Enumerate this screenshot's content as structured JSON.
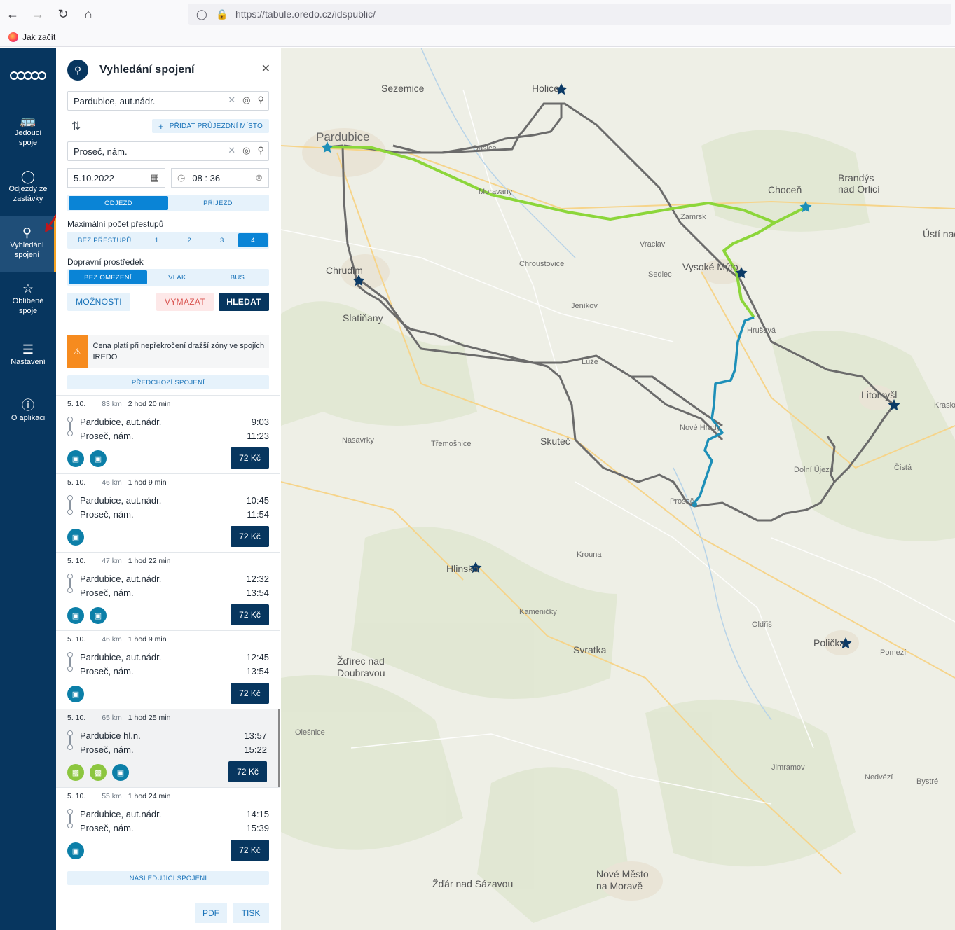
{
  "browser": {
    "url": "https://tabule.oredo.cz/idspublic/",
    "bookmark": "Jak začít"
  },
  "rail": {
    "logo": "OREDO",
    "items": [
      {
        "label": "Jedoucí spoje",
        "icon": "bus-icon"
      },
      {
        "label": "Odjezdy ze zastávky",
        "icon": "departures-icon"
      },
      {
        "label": "Vyhledání spojení",
        "icon": "search-icon"
      },
      {
        "label": "Oblíbené spoje",
        "icon": "star-icon"
      },
      {
        "label": "Nastavení",
        "icon": "sliders-icon"
      },
      {
        "label": "O aplikaci",
        "icon": "help-icon"
      }
    ]
  },
  "panel": {
    "title": "Vyhledání spojení",
    "from": "Pardubice, aut.nádr.",
    "to": "Proseč, nám.",
    "via_label": "PŘIDAT PRŮJEZDNÍ MÍSTO",
    "date": "5.10.2022",
    "time": "08 : 36",
    "direction": {
      "options": [
        "ODJEZD",
        "PŘÍJEZD"
      ],
      "selected": "ODJEZD"
    },
    "transfers_label": "Maximální počet přestupů",
    "transfers": {
      "options": [
        "BEZ PŘESTUPŮ",
        "1",
        "2",
        "3",
        "4"
      ],
      "selected": "4"
    },
    "transport_label": "Dopravní prostředek",
    "transport": {
      "options": [
        "BEZ OMEZENÍ",
        "VLAK",
        "BUS"
      ],
      "selected": "BEZ OMEZENÍ"
    },
    "options_btn": "MOŽNOSTI",
    "clear_btn": "VYMAZAT",
    "search_btn": "HLEDAT",
    "notice": "Cena platí při nepřekročení dražší zóny ve spojích IREDO",
    "prev": "PŘEDCHOZÍ SPOJENÍ",
    "next": "NÁSLEDUJÍCÍ SPOJENÍ",
    "pdf": "PDF",
    "print": "TISK"
  },
  "connections": [
    {
      "date": "5. 10.",
      "km": "83 km",
      "dur": "2 hod 20 min",
      "from": "Pardubice, aut.nádr.",
      "to": "Proseč, nám.",
      "dep": "9:03",
      "arr": "11:23",
      "modes": [
        "bus",
        "bus"
      ],
      "price": "72 Kč"
    },
    {
      "date": "5. 10.",
      "km": "46 km",
      "dur": "1 hod 9 min",
      "from": "Pardubice, aut.nádr.",
      "to": "Proseč, nám.",
      "dep": "10:45",
      "arr": "11:54",
      "modes": [
        "bus"
      ],
      "price": "72 Kč"
    },
    {
      "date": "5. 10.",
      "km": "47 km",
      "dur": "1 hod 22 min",
      "from": "Pardubice, aut.nádr.",
      "to": "Proseč, nám.",
      "dep": "12:32",
      "arr": "13:54",
      "modes": [
        "bus",
        "bus"
      ],
      "price": "72 Kč"
    },
    {
      "date": "5. 10.",
      "km": "46 km",
      "dur": "1 hod 9 min",
      "from": "Pardubice, aut.nádr.",
      "to": "Proseč, nám.",
      "dep": "12:45",
      "arr": "13:54",
      "modes": [
        "bus"
      ],
      "price": "72 Kč"
    },
    {
      "date": "5. 10.",
      "km": "65 km",
      "dur": "1 hod 25 min",
      "from": "Pardubice hl.n.",
      "to": "Proseč, nám.",
      "dep": "13:57",
      "arr": "15:22",
      "modes": [
        "train",
        "train",
        "bus"
      ],
      "price": "72 Kč"
    },
    {
      "date": "5. 10.",
      "km": "55 km",
      "dur": "1 hod 24 min",
      "from": "Pardubice, aut.nádr.",
      "to": "Proseč, nám.",
      "dep": "14:15",
      "arr": "15:39",
      "modes": [
        "bus"
      ],
      "price": "72 Kč"
    }
  ],
  "map": {
    "places": [
      "Pardubice",
      "Sezemice",
      "Holice",
      "Chroustovice",
      "Chrudim",
      "Slatiňany",
      "Vysoké Mýto",
      "Choceň",
      "Brandýs nad Orlicí",
      "Litomyšl",
      "Skuteč",
      "Hlinsko",
      "Polička",
      "Svratka",
      "Žďírec nad Doubravou",
      "Nové Město na Moravě",
      "Žďár nad Sázavou",
      "Proseč",
      "Dašice",
      "Moravany",
      "Luže",
      "Vraclav",
      "Zámrsk",
      "Hrušová",
      "Dolní Újezd",
      "Nasavrky",
      "Třemošnice",
      "Sedlec",
      "Ústí nad Orlicí",
      "Jeníkov",
      "Kraskov",
      "Bystré",
      "Kameničky",
      "Krouna",
      "Čistá",
      "Oldřiš",
      "Pomezí",
      "Jimramov",
      "Nedvězí",
      "Olešnice",
      "Nové Hrady",
      "Vysoké Mýto"
    ],
    "colors": {
      "route_train": "#8cd63a",
      "route_bus": "#1d8fb8",
      "other_routes": "#6e6e6e",
      "stop_star": "#0b3a66"
    }
  }
}
